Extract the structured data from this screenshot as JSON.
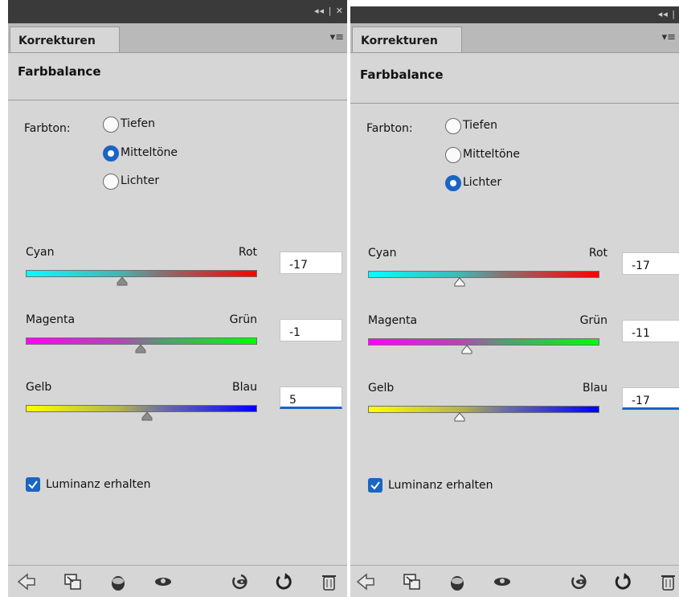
{
  "panels": [
    {
      "tab": "Korrekturen",
      "title": "Farbbalance",
      "tone": {
        "label": "Farbton:",
        "options": [
          "Tiefen",
          "Mitteltöne",
          "Lichter"
        ],
        "selected": "Mitteltöne"
      },
      "sliders": [
        {
          "left": "Cyan",
          "right": "Rot",
          "value": "-17"
        },
        {
          "left": "Magenta",
          "right": "Grün",
          "value": "-1"
        },
        {
          "left": "Gelb",
          "right": "Blau",
          "value": "5"
        }
      ],
      "active_input": 2,
      "thumb_style": "filled",
      "preserve_luminosity": {
        "label": "Luminanz erhalten",
        "checked": true
      }
    },
    {
      "tab": "Korrekturen",
      "title": "Farbbalance",
      "tone": {
        "label": "Farbton:",
        "options": [
          "Tiefen",
          "Mitteltöne",
          "Lichter"
        ],
        "selected": "Lichter"
      },
      "sliders": [
        {
          "left": "Cyan",
          "right": "Rot",
          "value": "-17"
        },
        {
          "left": "Magenta",
          "right": "Grün",
          "value": "-11"
        },
        {
          "left": "Gelb",
          "right": "Blau",
          "value": "-17"
        }
      ],
      "active_input": 2,
      "thumb_style": "hollow",
      "preserve_luminosity": {
        "label": "Luminanz erhalten",
        "checked": true
      }
    }
  ],
  "colors": {
    "accent": "#1a64c4",
    "panel": "#d6d6d6",
    "titlebar": "#3a3a3a"
  },
  "toolbar_icons": [
    "back-arrow-icon",
    "clip-to-layer-icon",
    "view-previous-state-icon",
    "visibility-eye-icon",
    "reset-icon",
    "refresh-icon",
    "trash-icon"
  ]
}
